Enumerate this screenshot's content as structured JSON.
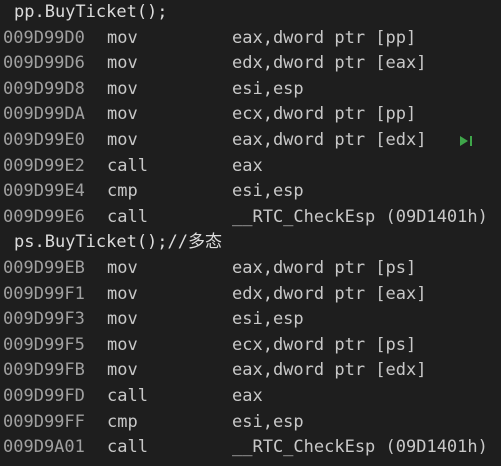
{
  "lines": [
    {
      "kind": "source",
      "text": "pp.BuyTicket();"
    },
    {
      "kind": "asm",
      "addr": "009D99D0",
      "mnemonic": "mov",
      "operands": "eax,dword ptr [pp]"
    },
    {
      "kind": "asm",
      "addr": "009D99D6",
      "mnemonic": "mov",
      "operands": "edx,dword ptr [eax]"
    },
    {
      "kind": "asm",
      "addr": "009D99D8",
      "mnemonic": "mov",
      "operands": "esi,esp"
    },
    {
      "kind": "asm",
      "addr": "009D99DA",
      "mnemonic": "mov",
      "operands": "ecx,dword ptr [pp]"
    },
    {
      "kind": "asm",
      "addr": "009D99E0",
      "mnemonic": "mov",
      "operands": "eax,dword ptr [edx]"
    },
    {
      "kind": "asm",
      "addr": "009D99E2",
      "mnemonic": "call",
      "operands": "eax"
    },
    {
      "kind": "asm",
      "addr": "009D99E4",
      "mnemonic": "cmp",
      "operands": "esi,esp"
    },
    {
      "kind": "asm",
      "addr": "009D99E6",
      "mnemonic": "call",
      "operands": "__RTC_CheckEsp (09D1401h)"
    },
    {
      "kind": "source",
      "text": "ps.BuyTicket();//多态"
    },
    {
      "kind": "asm",
      "addr": "009D99EB",
      "mnemonic": "mov",
      "operands": "eax,dword ptr [ps]"
    },
    {
      "kind": "asm",
      "addr": "009D99F1",
      "mnemonic": "mov",
      "operands": "edx,dword ptr [eax]"
    },
    {
      "kind": "asm",
      "addr": "009D99F3",
      "mnemonic": "mov",
      "operands": "esi,esp"
    },
    {
      "kind": "asm",
      "addr": "009D99F5",
      "mnemonic": "mov",
      "operands": "ecx,dword ptr [ps]"
    },
    {
      "kind": "asm",
      "addr": "009D99FB",
      "mnemonic": "mov",
      "operands": "eax,dword ptr [edx]"
    },
    {
      "kind": "asm",
      "addr": "009D99FD",
      "mnemonic": "call",
      "operands": "eax"
    },
    {
      "kind": "asm",
      "addr": "009D99FF",
      "mnemonic": "cmp",
      "operands": "esi,esp"
    },
    {
      "kind": "asm",
      "addr": "009D9A01",
      "mnemonic": "call",
      "operands": "__RTC_CheckEsp (09D1401h)"
    }
  ],
  "marker": {
    "icon": "run-to-cursor-icon",
    "line_index": 5,
    "color": "#3fa64a"
  }
}
